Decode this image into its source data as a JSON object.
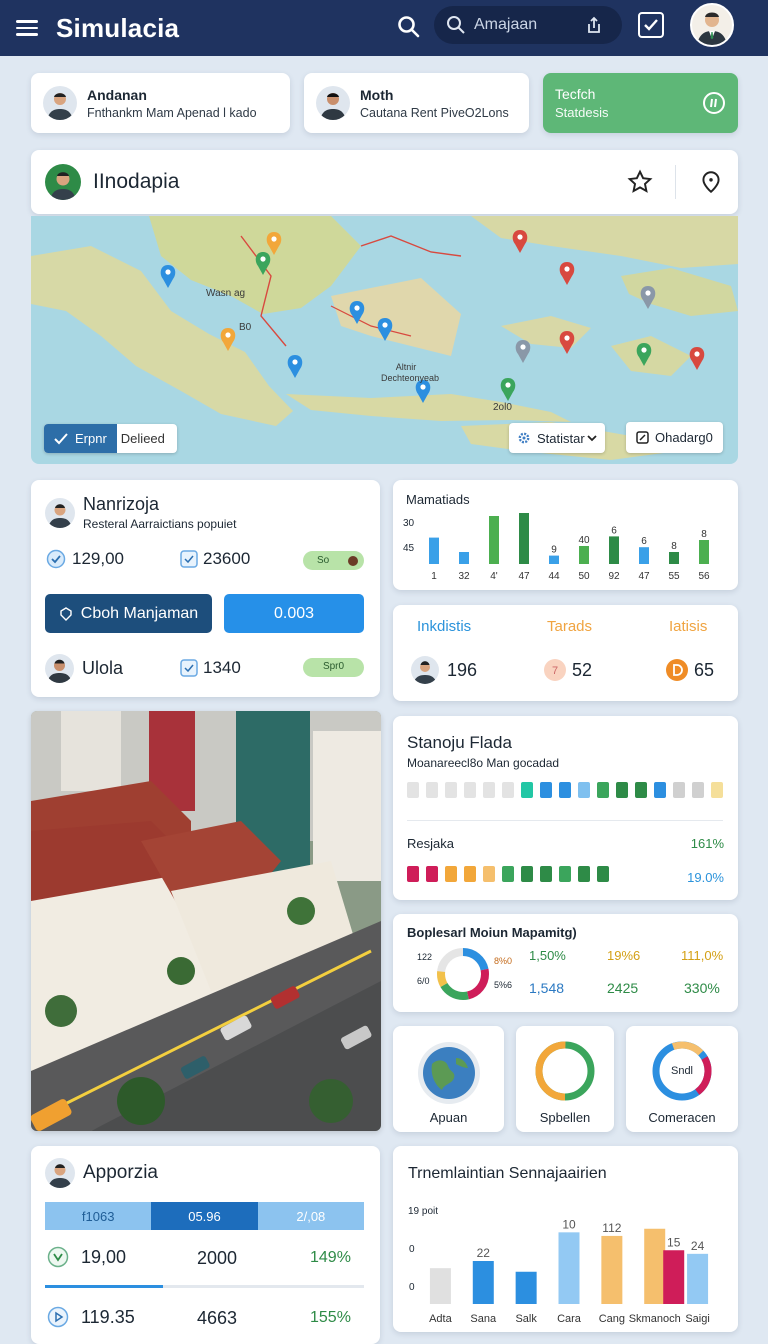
{
  "app": {
    "title": "Simulacia"
  },
  "search": {
    "placeholder": "Amajaan"
  },
  "profiles": [
    {
      "name": "Andanan",
      "desc": "Fnthankm Mam Apenad l kado"
    },
    {
      "name": "Moth",
      "desc": "Cautana Rent PiveO2Lons"
    }
  ],
  "tech_card": {
    "title": "Tecfch",
    "subtitle": "Statdesis"
  },
  "map_header": {
    "title": "IInodapia"
  },
  "map": {
    "labels": [
      "Wasn ag",
      "Altnir Dechteonyeab",
      "B0",
      "2ol0"
    ],
    "toggle_left": "Erpnr",
    "toggle_right": "Delieed",
    "stat_select": "Statistar",
    "download_label": "Ohadarg0"
  },
  "nanr_card": {
    "title": "Nanrizoja",
    "subtitle": "Resteral Aarraictians popuiet",
    "stat1": "129,00",
    "stat2": "23600",
    "pill1": "So",
    "btn_dark": "Cboh Manjaman",
    "btn_blue": "0.003",
    "name2": "Ulola",
    "stat3": "1340",
    "pill2": "Spr0"
  },
  "bar_chart_1": {
    "title": "Mamatiads",
    "y_labels": [
      "30",
      "45"
    ]
  },
  "stats_row": {
    "headers": [
      "Inkdistis",
      "Tarads",
      "Iatisis"
    ],
    "values": [
      "196",
      "52",
      "65"
    ]
  },
  "stanoju": {
    "title": "Stanoju Flada",
    "subtitle": "Moanareecl8o Man gocadad",
    "resjaka": "Resjaka",
    "pct1": "161%",
    "pct2": "19.0%"
  },
  "boples": {
    "title": "Boplesarl Moiun Mapamitg)",
    "ring_labels": [
      "122",
      "6/0",
      "8%0",
      "5%6"
    ],
    "values": [
      "1,50%",
      "19%6",
      "111,0%",
      "1,548",
      "2425",
      "330%"
    ]
  },
  "mini_cards": [
    "Apuan",
    "Spbellen",
    "Comeracen"
  ],
  "mini_ring_text": "Sndl",
  "apporzia": {
    "title": "Apporzia",
    "seg": [
      "f1063",
      "05.96",
      "2/,08"
    ],
    "r1": [
      "19,00",
      "2000",
      "149%"
    ],
    "r2": [
      "119.35",
      "4663",
      "155%"
    ]
  },
  "trend": {
    "title": "Trnemlaintian Sennajaairien",
    "ylabel": "19 poit"
  },
  "chart_data": [
    {
      "type": "bar",
      "title": "Mamatiads",
      "categories": [
        "1",
        "32",
        "4'",
        "47",
        "44",
        "50",
        "92",
        "47",
        "55",
        "56"
      ],
      "series": [
        {
          "values": [
            44,
            20,
            80,
            85,
            14,
            30,
            46,
            28,
            20,
            40
          ]
        }
      ],
      "value_labels": [
        "",
        "",
        "",
        "",
        "9",
        "40",
        "6",
        "6",
        "8",
        "8"
      ],
      "colors": [
        "#3aa0e8",
        "#3aa0e8",
        "#4caf50",
        "#2e8b47",
        "#3aa0e8",
        "#4caf50",
        "#2e8b47",
        "#3aa0e8",
        "#2e8b47",
        "#4caf50"
      ]
    },
    {
      "type": "bar",
      "title": "Trnemlaintian Sennajaairien",
      "categories": [
        "Adta",
        "Sana",
        "Salk",
        "Cara",
        "Cang",
        "Skmanoch",
        "Saigi"
      ],
      "series": [
        {
          "values": [
            10,
            12,
            9,
            20,
            19,
            21,
            14
          ]
        },
        {
          "values": [
            0,
            0,
            0,
            0,
            0,
            15,
            0
          ]
        }
      ],
      "value_labels": [
        "",
        "22",
        "",
        "10",
        "112",
        "15",
        "24"
      ],
      "colors": [
        "#e0e0e0",
        "#2c8fe0",
        "#2c8fe0",
        "#93c9f3",
        "#f5bf6d",
        "#f5bf6d",
        "#93c9f3"
      ],
      "overlay_color": "#cf1d59",
      "ylim": [
        0,
        24
      ],
      "y_ticks": [
        "0",
        "0"
      ]
    }
  ]
}
